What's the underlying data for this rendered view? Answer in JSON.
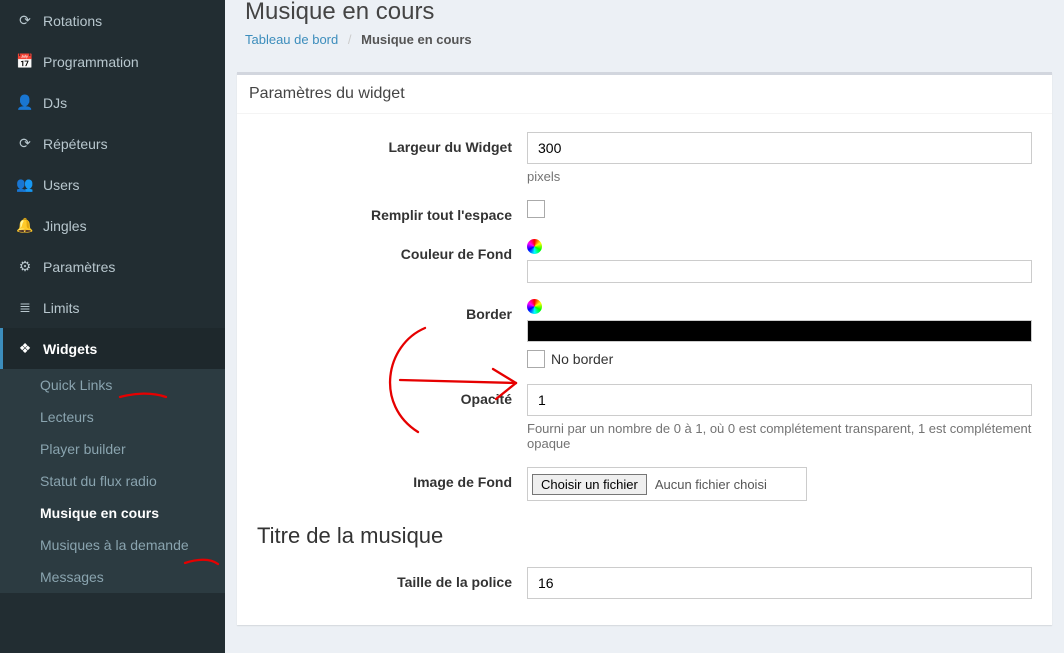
{
  "sidebar": {
    "items": [
      {
        "label": "Rotations",
        "icon": "⟳"
      },
      {
        "label": "Programmation",
        "icon": "📅"
      },
      {
        "label": "DJs",
        "icon": "👤"
      },
      {
        "label": "Répéteurs",
        "icon": "⟳"
      },
      {
        "label": "Users",
        "icon": "👥"
      },
      {
        "label": "Jingles",
        "icon": "🔔"
      },
      {
        "label": "Paramètres",
        "icon": "⚙"
      },
      {
        "label": "Limits",
        "icon": "≣"
      },
      {
        "label": "Widgets",
        "icon": "❖"
      }
    ],
    "widgets_submenu": [
      {
        "label": "Quick Links"
      },
      {
        "label": "Lecteurs"
      },
      {
        "label": "Player builder"
      },
      {
        "label": "Statut du flux radio"
      },
      {
        "label": "Musique en cours",
        "active": true
      },
      {
        "label": "Musiques à la demande"
      },
      {
        "label": "Messages"
      }
    ]
  },
  "header": {
    "title": "Musique en cours",
    "breadcrumb_root": "Tableau de bord",
    "breadcrumb_current": "Musique en cours"
  },
  "panel": {
    "title": "Paramètres du widget",
    "fields": {
      "width_label": "Largeur du Widget",
      "width_value": "300",
      "width_help": "pixels",
      "fill_label": "Remplir tout l'espace",
      "bg_label": "Couleur de Fond",
      "border_label": "Border",
      "no_border_label": "No border",
      "opacity_label": "Opacité",
      "opacity_value": "1",
      "opacity_help": "Fourni par un nombre de 0 à 1, où 0 est complétement transparent, 1 est complétement opaque",
      "bg_image_label": "Image de Fond",
      "file_button": "Choisir un fichier",
      "file_none": "Aucun fichier choisi"
    },
    "section2_title": "Titre de la musique",
    "font_size_label": "Taille de la police",
    "font_size_value": "16"
  }
}
